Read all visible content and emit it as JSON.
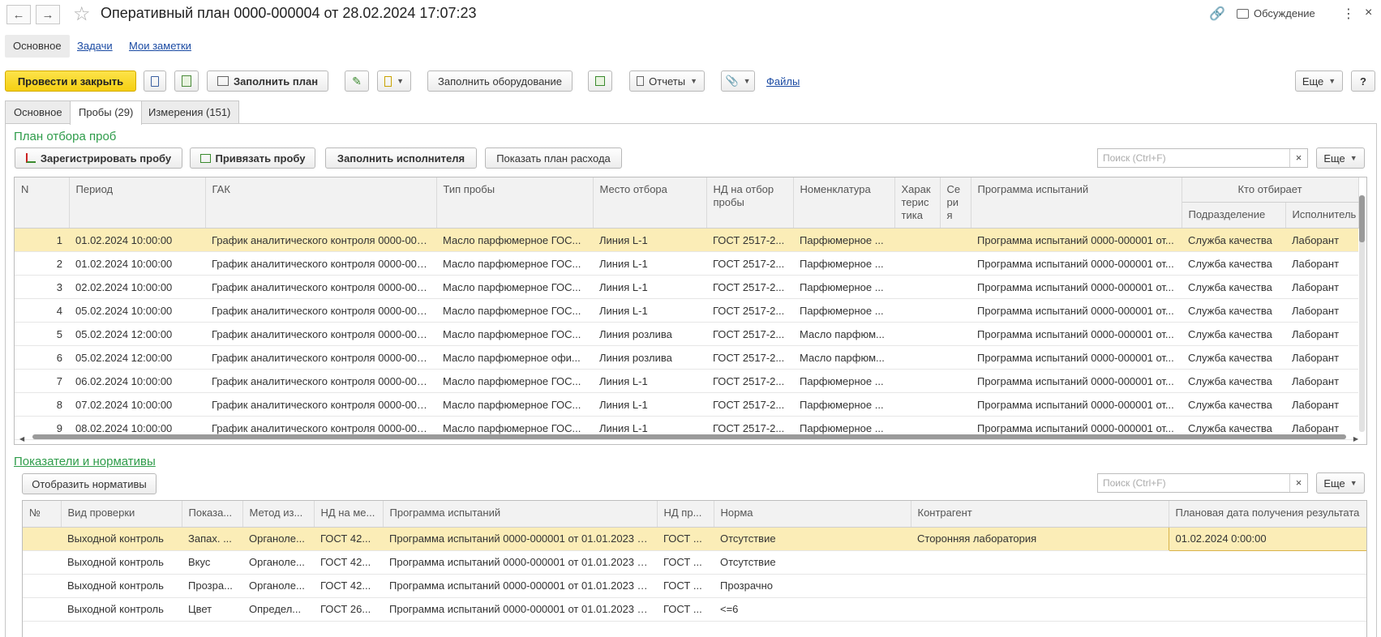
{
  "window": {
    "title": "Оперативный план 0000-000004 от 28.02.2024 17:07:23",
    "discussion_label": "Обсуждение"
  },
  "section_nav": [
    {
      "label": "Основное"
    },
    {
      "label": "Задачи"
    },
    {
      "label": "Мои заметки"
    }
  ],
  "toolbar": {
    "post_close_label": "Провести и закрыть",
    "fill_plan_label": "Заполнить план",
    "fill_equipment_label": "Заполнить оборудование",
    "reports_label": "Отчеты",
    "files_label": "Файлы",
    "more_label": "Еще",
    "help_label": "?"
  },
  "tabs": [
    {
      "label": "Основное"
    },
    {
      "label": "Пробы (29)"
    },
    {
      "label": "Измерения (151)"
    }
  ],
  "samples": {
    "title": "План отбора проб",
    "register_label": "Зарегистрировать пробу",
    "link_label": "Привязать пробу",
    "fill_executor_label": "Заполнить исполнителя",
    "show_plan_label": "Показать план расхода",
    "search_placeholder": "Поиск (Ctrl+F)",
    "more_label": "Еще",
    "columns": [
      "N",
      "Период",
      "ГАК",
      "Тип пробы",
      "Место отбора",
      "НД на отбор пробы",
      "Номенклатура",
      "Характеристика",
      "Серия",
      "Программа испытаний",
      "Кто отбирает",
      "Подразделение",
      "Исполнитель"
    ],
    "rows": [
      {
        "n": "1",
        "period": "01.02.2024 10:00:00",
        "gak": "График аналитического контроля 0000-000...",
        "type": "Масло парфюмерное ГОС...",
        "place": "Линия L-1",
        "nd": "ГОСТ 2517-2...",
        "nomen": "Парфюмерное ...",
        "prog": "Программа испытаний 0000-000001 от...",
        "dept": "Служба качества",
        "exec": "Лаборант"
      },
      {
        "n": "2",
        "period": "01.02.2024 10:00:00",
        "gak": "График аналитического контроля 0000-000...",
        "type": "Масло парфюмерное ГОС...",
        "place": "Линия L-1",
        "nd": "ГОСТ 2517-2...",
        "nomen": "Парфюмерное ...",
        "prog": "Программа испытаний 0000-000001 от...",
        "dept": "Служба качества",
        "exec": "Лаборант"
      },
      {
        "n": "3",
        "period": "02.02.2024 10:00:00",
        "gak": "График аналитического контроля 0000-000...",
        "type": "Масло парфюмерное ГОС...",
        "place": "Линия L-1",
        "nd": "ГОСТ 2517-2...",
        "nomen": "Парфюмерное ...",
        "prog": "Программа испытаний 0000-000001 от...",
        "dept": "Служба качества",
        "exec": "Лаборант"
      },
      {
        "n": "4",
        "period": "05.02.2024 10:00:00",
        "gak": "График аналитического контроля 0000-000...",
        "type": "Масло парфюмерное ГОС...",
        "place": "Линия L-1",
        "nd": "ГОСТ 2517-2...",
        "nomen": "Парфюмерное ...",
        "prog": "Программа испытаний 0000-000001 от...",
        "dept": "Служба качества",
        "exec": "Лаборант"
      },
      {
        "n": "5",
        "period": "05.02.2024 12:00:00",
        "gak": "График аналитического контроля 0000-000...",
        "type": "Масло парфюмерное ГОС...",
        "place": "Линия розлива",
        "nd": "ГОСТ 2517-2...",
        "nomen": "Масло парфюм...",
        "prog": "Программа испытаний 0000-000001 от...",
        "dept": "Служба качества",
        "exec": "Лаборант"
      },
      {
        "n": "6",
        "period": "05.02.2024 12:00:00",
        "gak": "График аналитического контроля 0000-000...",
        "type": "Масло парфюмерное офи...",
        "place": "Линия розлива",
        "nd": "ГОСТ 2517-2...",
        "nomen": "Масло парфюм...",
        "prog": "Программа испытаний 0000-000001 от...",
        "dept": "Служба качества",
        "exec": "Лаборант"
      },
      {
        "n": "7",
        "period": "06.02.2024 10:00:00",
        "gak": "График аналитического контроля 0000-000...",
        "type": "Масло парфюмерное ГОС...",
        "place": "Линия L-1",
        "nd": "ГОСТ 2517-2...",
        "nomen": "Парфюмерное ...",
        "prog": "Программа испытаний 0000-000001 от...",
        "dept": "Служба качества",
        "exec": "Лаборант"
      },
      {
        "n": "8",
        "period": "07.02.2024 10:00:00",
        "gak": "График аналитического контроля 0000-000...",
        "type": "Масло парфюмерное ГОС...",
        "place": "Линия L-1",
        "nd": "ГОСТ 2517-2...",
        "nomen": "Парфюмерное ...",
        "prog": "Программа испытаний 0000-000001 от...",
        "dept": "Служба качества",
        "exec": "Лаборант"
      },
      {
        "n": "9",
        "period": "08.02.2024 10:00:00",
        "gak": "График аналитического контроля 0000-000...",
        "type": "Масло парфюмерное ГОС...",
        "place": "Линия L-1",
        "nd": "ГОСТ 2517-2...",
        "nomen": "Парфюмерное ...",
        "prog": "Программа испытаний 0000-000001 от...",
        "dept": "Служба качества",
        "exec": "Лаборант"
      }
    ]
  },
  "norms": {
    "title": "Показатели и нормативы",
    "show_norms_label": "Отобразить нормативы",
    "search_placeholder": "Поиск (Ctrl+F)",
    "more_label": "Еще",
    "columns": [
      "№",
      "Вид проверки",
      "Показа...",
      "Метод из...",
      "НД на ме...",
      "Программа испытаний",
      "НД пр...",
      "Норма",
      "Контрагент",
      "Плановая дата получения результата"
    ],
    "rows": [
      {
        "num": "",
        "kind": "Выходной контроль",
        "ind": "Запах. ...",
        "method": "Органоле...",
        "nd": "ГОСТ 42...",
        "prog": "Программа испытаний 0000-000001 от 01.01.2023 0...",
        "ndp": "ГОСТ ...",
        "norm": "Отсутствие",
        "contr": "Сторонняя лаборатория",
        "date": "01.02.2024 0:00:00"
      },
      {
        "num": "",
        "kind": "Выходной контроль",
        "ind": "Вкус",
        "method": "Органоле...",
        "nd": "ГОСТ 42...",
        "prog": "Программа испытаний 0000-000001 от 01.01.2023 0...",
        "ndp": "ГОСТ ...",
        "norm": "Отсутствие",
        "contr": "",
        "date": ""
      },
      {
        "num": "",
        "kind": "Выходной контроль",
        "ind": "Прозра...",
        "method": "Органоле...",
        "nd": "ГОСТ 42...",
        "prog": "Программа испытаний 0000-000001 от 01.01.2023 0...",
        "ndp": "ГОСТ ...",
        "norm": "Прозрачно",
        "contr": "",
        "date": ""
      },
      {
        "num": "",
        "kind": "Выходной контроль",
        "ind": "Цвет",
        "method": "Определ...",
        "nd": "ГОСТ 26...",
        "prog": "Программа испытаний 0000-000001 от 01.01.2023 0...",
        "ndp": "ГОСТ ...",
        "norm": "<=6",
        "contr": "",
        "date": ""
      }
    ]
  }
}
